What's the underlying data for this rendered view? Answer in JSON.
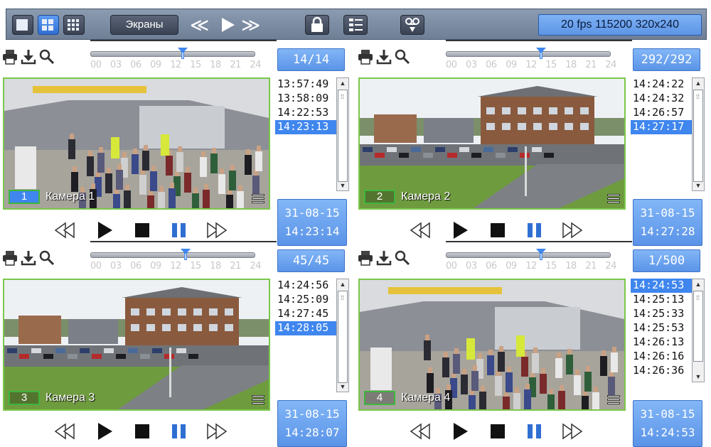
{
  "toolbar": {
    "screens_label": "Экраны",
    "fps_label": "20 fps 115200 320x240",
    "layout_buttons": [
      "layout-1x1-icon",
      "layout-2x2-icon",
      "layout-3x3-icon"
    ],
    "nav_icons": [
      "rewind-double-icon",
      "play-icon",
      "forward-double-icon"
    ],
    "lock_icon": "lock-icon",
    "list_icon": "list-icon",
    "cassette_icon": "tape-icon"
  },
  "timeline_labels": [
    "00",
    "03",
    "06",
    "09",
    "12",
    "15",
    "18",
    "21",
    "24"
  ],
  "cameras": [
    {
      "number": "1",
      "name": "Камера 1",
      "counter": "14/14",
      "times": [
        "13:57:49",
        "13:58:09",
        "14:22:53",
        "14:23:13"
      ],
      "selected_time_index": 3,
      "date": "31-08-15",
      "time": "14:23:14",
      "scene": "indoor",
      "timeline_position": 0.56
    },
    {
      "number": "2",
      "name": "Камера 2",
      "counter": "292/292",
      "times": [
        "14:24:22",
        "14:24:32",
        "14:26:57",
        "14:27:17"
      ],
      "selected_time_index": 3,
      "date": "31-08-15",
      "time": "14:27:28",
      "scene": "outdoor",
      "timeline_position": 0.58
    },
    {
      "number": "3",
      "name": "Камера 3",
      "counter": "45/45",
      "times": [
        "14:24:56",
        "14:25:09",
        "14:27:45",
        "14:28:05"
      ],
      "selected_time_index": 3,
      "date": "31-08-15",
      "time": "14:28:07",
      "scene": "outdoor",
      "timeline_position": 0.58
    },
    {
      "number": "4",
      "name": "Камера 4",
      "counter": "1/500",
      "times": [
        "14:24:53",
        "14:25:13",
        "14:25:33",
        "14:25:53",
        "14:26:13",
        "14:26:16",
        "14:26:36"
      ],
      "selected_time_index": 0,
      "date": "31-08-15",
      "time": "14:24:53",
      "scene": "indoor",
      "timeline_position": 0.58
    }
  ],
  "colors": {
    "accent_blue": "#3f86ee",
    "camera_border_green": "#7ac84a"
  }
}
